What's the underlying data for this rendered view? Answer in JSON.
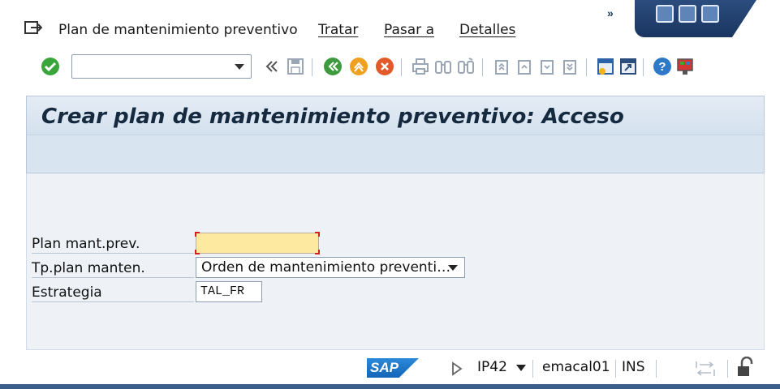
{
  "menubar": {
    "items": [
      {
        "label": "Plan de mantenimiento preventivo"
      },
      {
        "label": "Tratar"
      },
      {
        "label": "Pasar a"
      },
      {
        "label": "Detalles"
      }
    ],
    "overflow_glyph": "»"
  },
  "toolbar": {
    "command_field_value": "",
    "icons": [
      "checkmark-icon",
      "collapse-icon",
      "save-icon",
      "back-icon",
      "exit-icon",
      "cancel-icon",
      "print-icon",
      "find-icon",
      "find-next-icon",
      "first-page-icon",
      "previous-page-icon",
      "next-page-icon",
      "last-page-icon",
      "create-session-icon",
      "shortcut-icon",
      "help-icon",
      "customize-layout-icon"
    ]
  },
  "page": {
    "title": "Crear plan de mantenimiento preventivo: Acceso"
  },
  "form": {
    "plan_label": "Plan mant.prev.",
    "plan_value": "",
    "type_label": "Tp.plan manten.",
    "type_value": "Orden de mantenimiento preventi…",
    "strategy_label": "Estrategia",
    "strategy_value": "TAL_FR"
  },
  "status": {
    "logo_text": "SAP",
    "transaction": "IP42",
    "user": "emacal01",
    "mode": "INS"
  },
  "colors": {
    "title_bg": "#d8e4f0",
    "required_field_bg": "#fde9a0",
    "shell_blue": "#2b4d7e"
  }
}
